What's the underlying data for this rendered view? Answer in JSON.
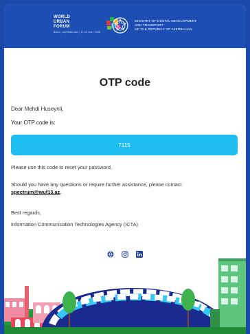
{
  "header": {
    "wuf_lines": [
      "WORLD",
      "URBAN",
      "FORUM"
    ],
    "wuf_sub": "BAKU, AZERBAIJAN | 17-22 MAY 2026",
    "ministry_lines": [
      "MINISTRY OF DIGITAL DEVELOPMENT",
      "AND TRANSPORT",
      "OF THE REPUBLIC OF AZERBAIJAN"
    ]
  },
  "email": {
    "title": "OTP code",
    "greeting": "Dear Mehdi Huseynli,",
    "otp_label": "Your OTP code is:",
    "otp_code": "7115",
    "reset_text": "Please use this code to reset your password.",
    "question_text": "Should you have any questions or require further assistance, please contact",
    "contact_email": "spectrum@wuf13.az",
    "contact_suffix": ".",
    "regards": "Best regards,",
    "signature": "Information Communication Technologies Agency (ICTA)"
  },
  "social": {
    "icons": [
      "globe-icon",
      "instagram-icon",
      "linkedin-icon"
    ],
    "color": "#1c3f99"
  },
  "colors": {
    "frame": "#1b49a9",
    "header": "#1c4eb4",
    "otp_box": "#1ebef1"
  }
}
